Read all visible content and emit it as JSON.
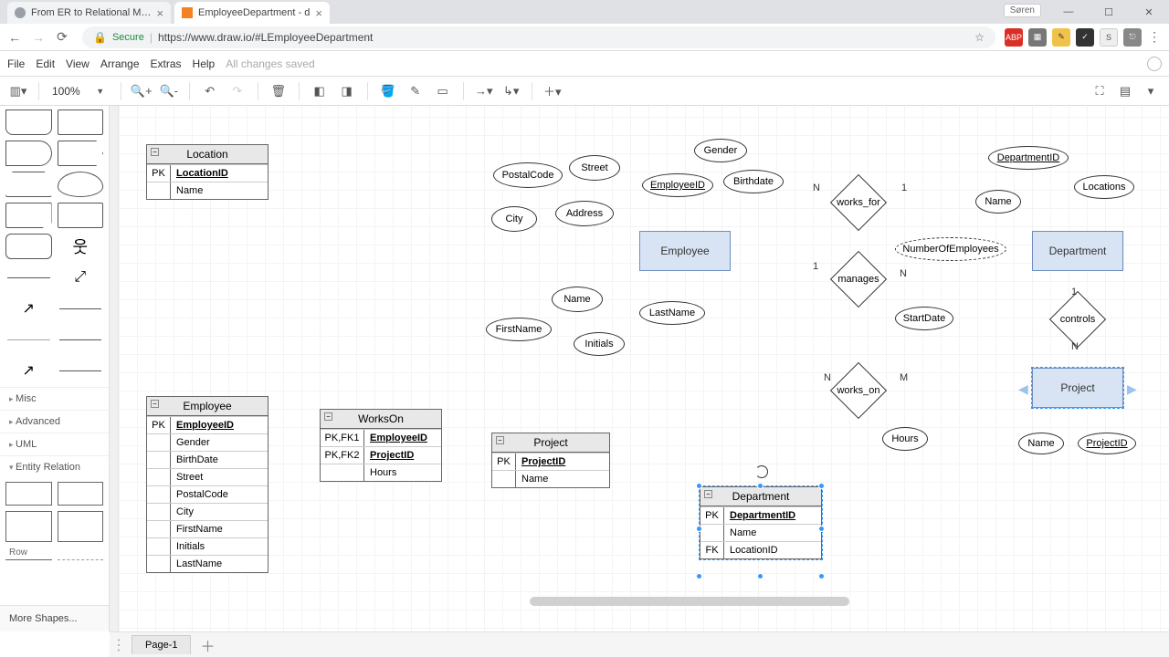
{
  "browser": {
    "tabs": [
      {
        "title": "From ER to Relational M…",
        "active": false
      },
      {
        "title": "EmployeeDepartment - d",
        "active": true
      }
    ],
    "user_chip": "Søren",
    "secure_label": "Secure",
    "url": "https://www.draw.io/#LEmployeeDepartment"
  },
  "menus": [
    "File",
    "Edit",
    "View",
    "Arrange",
    "Extras",
    "Help"
  ],
  "save_status": "All changes saved",
  "toolbar": {
    "zoom": "100%"
  },
  "sidebar": {
    "categories": [
      "Misc",
      "Advanced",
      "UML",
      "Entity Relation"
    ],
    "row_label": "Row",
    "more": "More Shapes..."
  },
  "er": {
    "entities": {
      "employee": "Employee",
      "department": "Department",
      "project": "Project"
    },
    "attrs": {
      "postalcode": "PostalCode",
      "street": "Street",
      "city": "City",
      "address": "Address",
      "employeeid": "EmployeeID",
      "gender": "Gender",
      "birthdate": "Birthdate",
      "name_emp": "Name",
      "firstname": "FirstName",
      "lastname": "LastName",
      "initials": "Initials",
      "numemp": "NumberOfEmployees",
      "startdate": "StartDate",
      "hours": "Hours",
      "deptid": "DepartmentID",
      "locations": "Locations",
      "name_dept": "Name",
      "name_proj": "Name",
      "projectid": "ProjectID"
    },
    "rels": {
      "works_for": "works_for",
      "manages": "manages",
      "works_on": "works_on",
      "controls": "controls"
    },
    "card": {
      "one": "1",
      "N": "N",
      "M": "M"
    }
  },
  "tables": {
    "location": {
      "title": "Location",
      "rows": [
        {
          "k": "PK",
          "v": "LocationID",
          "pk": true
        },
        {
          "k": "",
          "v": "Name"
        }
      ]
    },
    "employee": {
      "title": "Employee",
      "rows": [
        {
          "k": "PK",
          "v": "EmployeeID",
          "pk": true
        },
        {
          "k": "",
          "v": "Gender"
        },
        {
          "k": "",
          "v": "BirthDate"
        },
        {
          "k": "",
          "v": "Street"
        },
        {
          "k": "",
          "v": "PostalCode"
        },
        {
          "k": "",
          "v": "City"
        },
        {
          "k": "",
          "v": "FirstName"
        },
        {
          "k": "",
          "v": "Initials"
        },
        {
          "k": "",
          "v": "LastName"
        }
      ]
    },
    "workson": {
      "title": "WorksOn",
      "rows": [
        {
          "k": "PK,FK1",
          "v": "EmployeeID",
          "pk": true
        },
        {
          "k": "PK,FK2",
          "v": "ProjectID",
          "pk": true
        },
        {
          "k": "",
          "v": "Hours"
        }
      ]
    },
    "project": {
      "title": "Project",
      "rows": [
        {
          "k": "PK",
          "v": "ProjectID",
          "pk": true
        },
        {
          "k": "",
          "v": "Name"
        }
      ]
    },
    "department": {
      "title": "Department",
      "rows": [
        {
          "k": "PK",
          "v": "DepartmentID",
          "pk": true
        },
        {
          "k": "",
          "v": "Name"
        },
        {
          "k": "FK",
          "v": "LocationID"
        }
      ]
    }
  },
  "footer": {
    "page": "Page-1"
  }
}
